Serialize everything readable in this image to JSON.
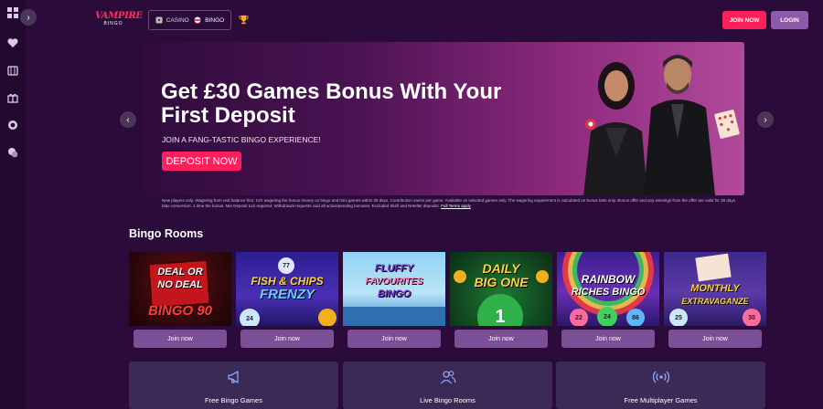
{
  "sidebar": {
    "icons": [
      "grid-icon",
      "heart-icon",
      "casino-icon",
      "gift-icon",
      "chip-icon",
      "chat-icon"
    ]
  },
  "header": {
    "logo_line1": "VAMPIRE",
    "logo_line2": "BINGO",
    "modes": [
      {
        "label": "CASINO",
        "icon": "casino-icon"
      },
      {
        "label": "BINGO",
        "icon": "bingo-icon",
        "active": true
      }
    ],
    "join_label": "JOIN NOW",
    "login_label": "LOGIN",
    "colors": {
      "join": "#ff1f5b",
      "login": "#8c5aa8"
    }
  },
  "hero": {
    "title": "Get £30 Games Bonus With Your First Deposit",
    "subtitle": "JOIN A FANG-TASTIC BINGO EXPERIENCE!",
    "cta": "DEPOSIT NOW",
    "terms": "New players only. Wagering from real balance first. 10X wagering the bonus money on bingo and mini games within 30 days. Contribution varies per game. Available on selected games only. The wagering requirement is calculated on bonus bets only. Bonus offer and any winnings from the offer are valid for 30 days. Max conversion: 1 time the bonus. Min Deposit £10 required. Withdrawal requests void all active/pending bonuses. Excluded Skrill and Neteller deposits.",
    "terms_link": "Full Terms apply"
  },
  "bingo_rooms": {
    "title": "Bingo Rooms",
    "rooms": [
      {
        "name": "DEAL OR NO DEAL BINGO 90",
        "line1": "DEAL OR",
        "line2": "NO DEAL",
        "line3": "BINGO 90",
        "button": "Join now"
      },
      {
        "name": "FISH & CHIPS FRENZY",
        "line1": "FISH & CHIPS",
        "line2": "FRENZY",
        "line3": "",
        "button": "Join now"
      },
      {
        "name": "FLUFFY FAVOURITES BINGO",
        "line1": "FLUFFY",
        "line2": "FAVOURITES",
        "line3": "BINGO",
        "button": "Join now"
      },
      {
        "name": "DAILY BIG ONE",
        "line1": "DAILY",
        "line2": "BIG ONE",
        "line3": "",
        "button": "Join now"
      },
      {
        "name": "RAINBOW RICHES BINGO",
        "line1": "RAINBOW",
        "line2": "RICHES BINGO",
        "line3": "",
        "button": "Join now"
      },
      {
        "name": "MONTHLY EXTRAVAGANZE",
        "line1": "MONTHLY",
        "line2": "EXTRAVAGANZE",
        "line3": "",
        "button": "Join now"
      }
    ]
  },
  "categories": [
    {
      "label": "Free Bingo Games",
      "icon": "megaphone-icon"
    },
    {
      "label": "Live Bingo Rooms",
      "icon": "users-icon"
    },
    {
      "label": "Free Multiplayer Games",
      "icon": "broadcast-icon"
    }
  ]
}
